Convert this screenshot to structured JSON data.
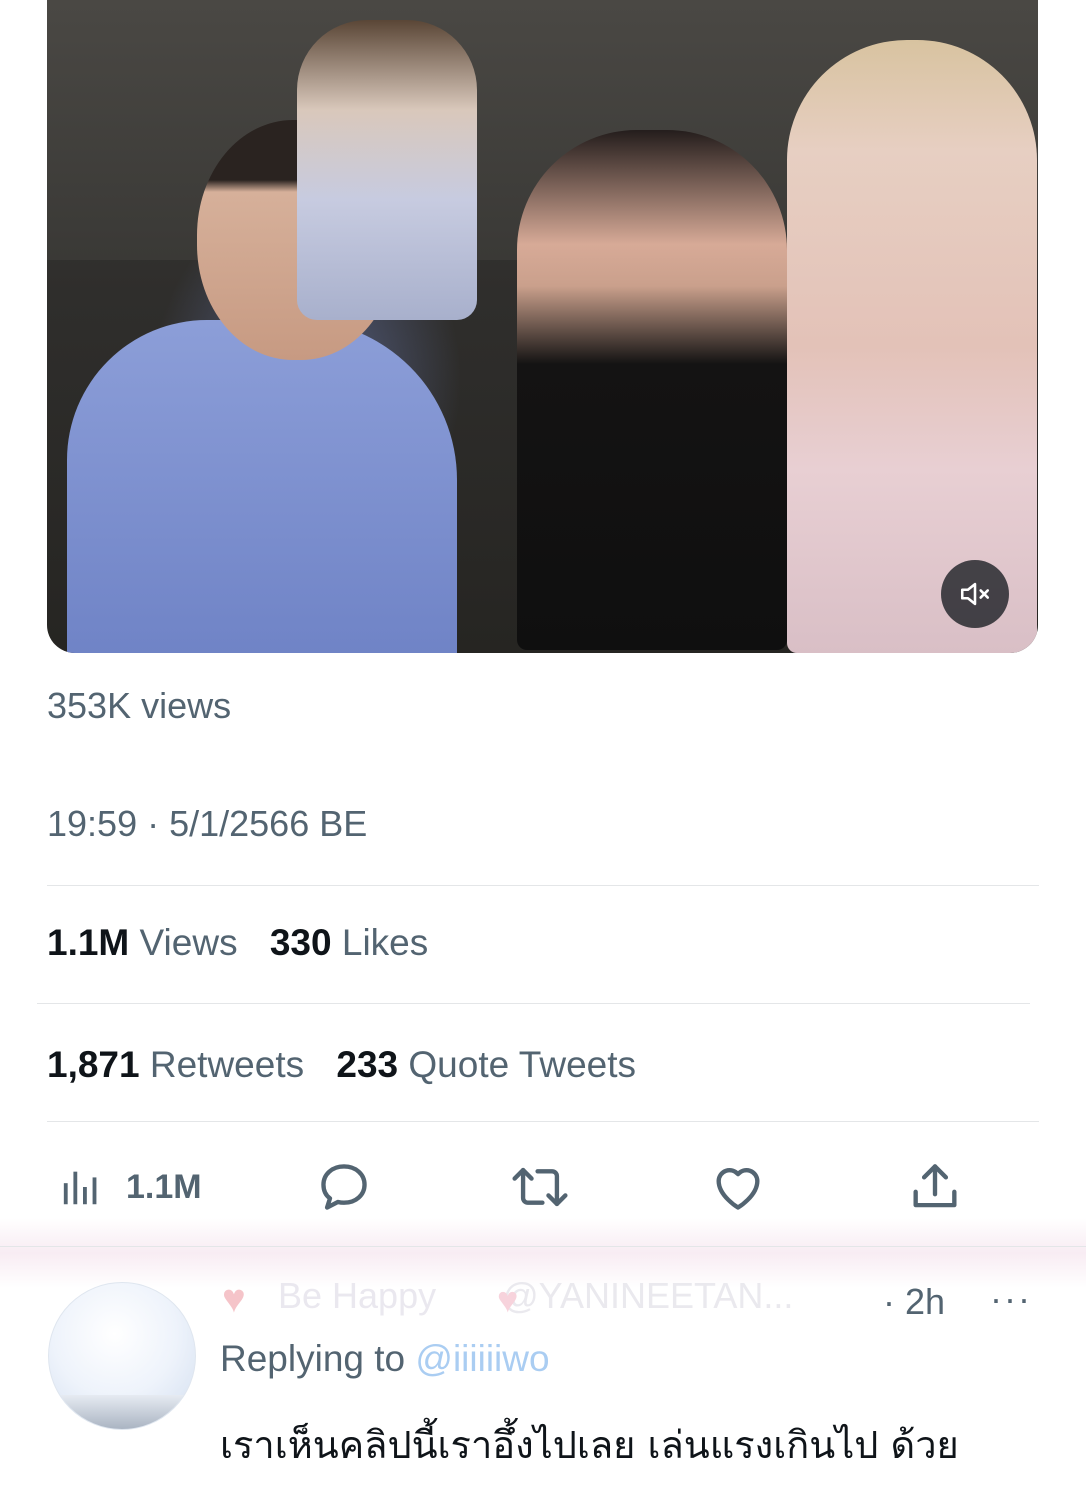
{
  "video": {
    "mute_icon": "speaker-muted-icon"
  },
  "tweet": {
    "views_small": "353K views",
    "timestamp": "19:59 · 5/1/2566 BE",
    "stats": {
      "views_count": "1.1M",
      "views_label": "Views",
      "likes_count": "330",
      "likes_label": "Likes",
      "retweets_count": "1,871",
      "retweets_label": "Retweets",
      "quotes_count": "233",
      "quotes_label": "Quote Tweets"
    },
    "actions": {
      "analytics_icon": "bar-chart-icon",
      "analytics_count": "1.1M",
      "reply_icon": "comment-icon",
      "retweet_icon": "retweet-icon",
      "like_icon": "heart-icon",
      "share_icon": "share-icon"
    }
  },
  "reply": {
    "name": "Be Happy",
    "handle": "@YANINEETAN...",
    "time": "· 2h",
    "more": "···",
    "replying_prefix": "Replying to",
    "replying_mention": "@iiiiiiwo",
    "text": "เราเห็นคลิปนี้เราอึ้งไปเลย เล่นแรงเกินไป ด้วย"
  },
  "colors": {
    "text_primary": "#0f1419",
    "text_secondary": "#536471",
    "divider": "#e4e6e8",
    "mention": "#1d9bf0"
  }
}
